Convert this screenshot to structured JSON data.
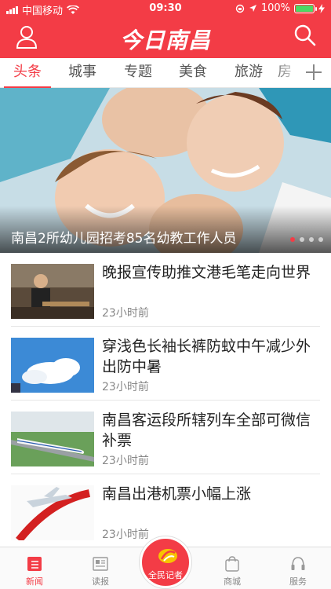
{
  "status_bar": {
    "carrier": "中国移动",
    "time": "09:30",
    "battery": "100%"
  },
  "header": {
    "title": "今日南昌",
    "icons": [
      "user-icon",
      "search-icon"
    ]
  },
  "tabs": [
    {
      "label": "头条",
      "active": true
    },
    {
      "label": "城事",
      "active": false
    },
    {
      "label": "专题",
      "active": false
    },
    {
      "label": "美食",
      "active": false
    },
    {
      "label": "旅游",
      "active": false
    },
    {
      "label": "房",
      "active": false
    }
  ],
  "banner": {
    "caption": "南昌2所幼儿园招考85名幼教工作人员",
    "slide_count": 4,
    "active_slide": 1
  },
  "news": [
    {
      "headline": "晚报宣传助推文港毛笔走向世界",
      "time": "23小时前"
    },
    {
      "headline": "穿浅色长袖长裤防蚊中午减少外出防中暑",
      "time": "23小时前"
    },
    {
      "headline": "南昌客运段所辖列车全部可微信补票",
      "time": "23小时前"
    },
    {
      "headline": "南昌出港机票小幅上涨",
      "time": "23小时前"
    }
  ],
  "bottom_nav": [
    {
      "label": "新闻",
      "icon": "news-icon",
      "active": true
    },
    {
      "label": "读报",
      "icon": "newspaper-icon",
      "active": false
    },
    {
      "label": "全民记者",
      "icon": "reporter-icon",
      "active": false
    },
    {
      "label": "商城",
      "icon": "shopping-bag-icon",
      "active": false
    },
    {
      "label": "服务",
      "icon": "headset-icon",
      "active": false
    }
  ],
  "colors": {
    "brand": "#f33c46",
    "battery_fill": "#4cd964",
    "muted_text": "#888888"
  }
}
